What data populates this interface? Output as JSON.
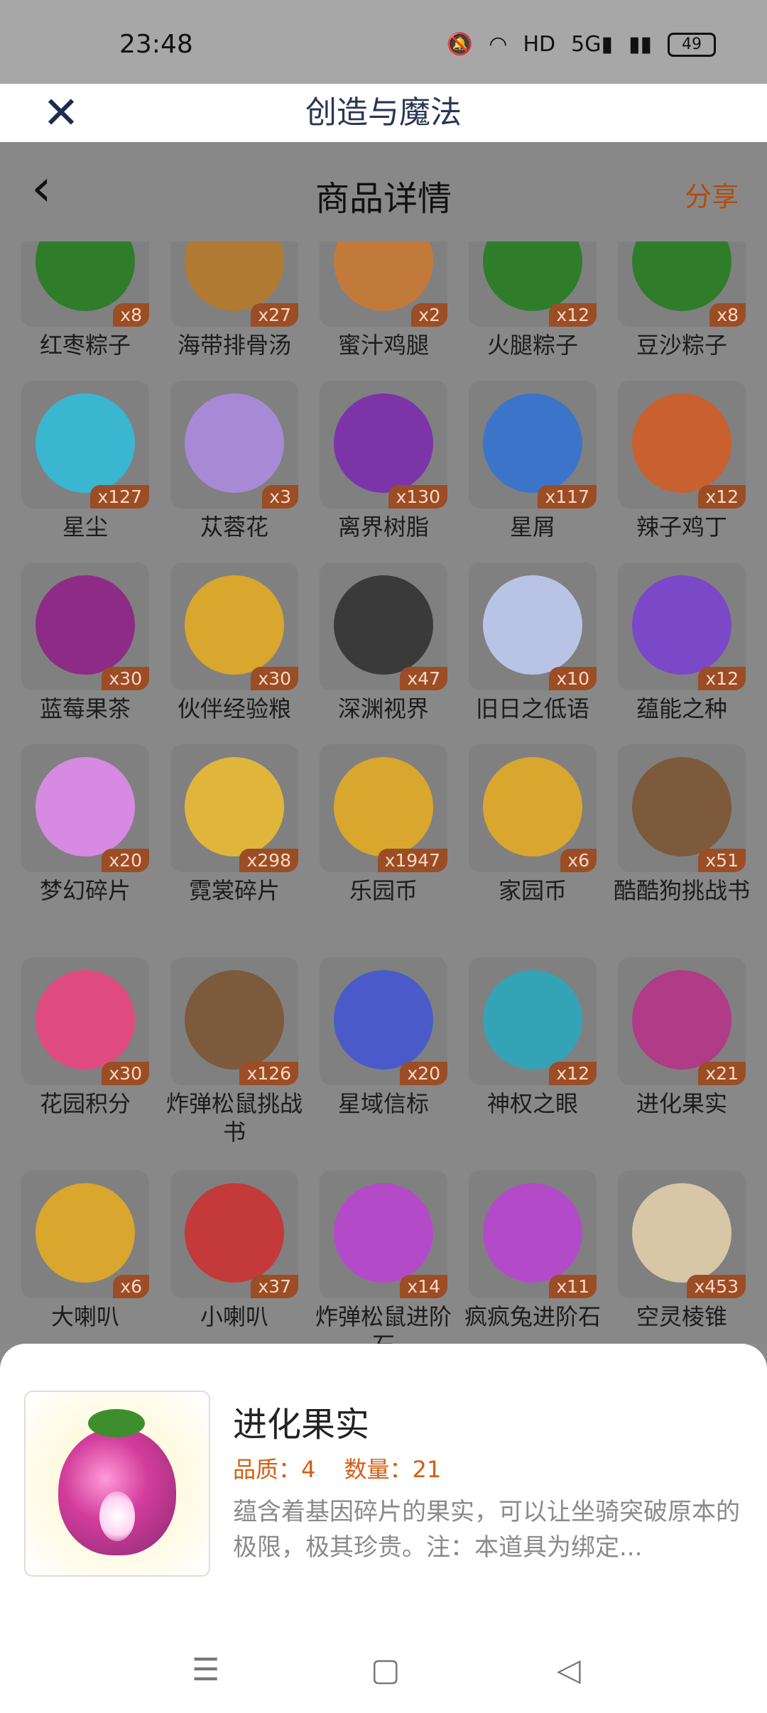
{
  "status_bar": {
    "time": "23:48",
    "battery": "49",
    "icons": [
      "bell-off-icon",
      "wifi-icon",
      "hd-icon",
      "signal-5g-icon",
      "signal-icon",
      "battery-icon"
    ]
  },
  "web_header": {
    "title": "创造与魔法"
  },
  "page_header": {
    "title": "商品详情",
    "share_label": "分享"
  },
  "items": [
    {
      "name": "红枣粽子",
      "count": "x8",
      "color": "#2f7d2a"
    },
    {
      "name": "海带排骨汤",
      "count": "x27",
      "color": "#b07a32"
    },
    {
      "name": "蜜汁鸡腿",
      "count": "x2",
      "color": "#c27a3b"
    },
    {
      "name": "火腿粽子",
      "count": "x12",
      "color": "#2f7d2a"
    },
    {
      "name": "豆沙粽子",
      "count": "x8",
      "color": "#2f7d2a"
    },
    {
      "name": "星尘",
      "count": "x127",
      "color": "#3ab6d1"
    },
    {
      "name": "苁蓉花",
      "count": "x3",
      "color": "#a78ad5"
    },
    {
      "name": "离界树脂",
      "count": "x130",
      "color": "#7b35a8"
    },
    {
      "name": "星屑",
      "count": "x117",
      "color": "#3c74c9"
    },
    {
      "name": "辣子鸡丁",
      "count": "x12",
      "color": "#c8612f"
    },
    {
      "name": "蓝莓果茶",
      "count": "x30",
      "color": "#8d2b86"
    },
    {
      "name": "伙伴经验粮",
      "count": "x30",
      "color": "#d9a62e"
    },
    {
      "name": "深渊视界",
      "count": "x47",
      "color": "#3a3a3a"
    },
    {
      "name": "旧日之低语",
      "count": "x10",
      "color": "#b9c3e5"
    },
    {
      "name": "蕴能之种",
      "count": "x12",
      "color": "#7b48c8"
    },
    {
      "name": "梦幻碎片",
      "count": "x20",
      "color": "#d78ae2"
    },
    {
      "name": "霓裳碎片",
      "count": "x298",
      "color": "#e0b53b"
    },
    {
      "name": "乐园币",
      "count": "x1947",
      "color": "#d9a62e"
    },
    {
      "name": "家园币",
      "count": "x6",
      "color": "#d9a62e"
    },
    {
      "name": "酷酷狗挑战书",
      "count": "x51",
      "color": "#7c5a3b"
    },
    {
      "name": "花园积分",
      "count": "x30",
      "color": "#e04c7f"
    },
    {
      "name": "炸弹松鼠挑战书",
      "count": "x126",
      "color": "#7c5a3b"
    },
    {
      "name": "星域信标",
      "count": "x20",
      "color": "#4a5bc9"
    },
    {
      "name": "神权之眼",
      "count": "x12",
      "color": "#35a3b6"
    },
    {
      "name": "进化果实",
      "count": "x21",
      "color": "#b03b86"
    },
    {
      "name": "大喇叭",
      "count": "x6",
      "color": "#d9a62e"
    },
    {
      "name": "小喇叭",
      "count": "x37",
      "color": "#c43a3a"
    },
    {
      "name": "炸弹松鼠进阶石",
      "count": "x14",
      "color": "#b34bc8"
    },
    {
      "name": "疯疯兔进阶石",
      "count": "x11",
      "color": "#b34bc8"
    },
    {
      "name": "空灵棱锥",
      "count": "x453",
      "color": "#d7c7a6"
    }
  ],
  "detail": {
    "name": "进化果实",
    "quality": "品质：4",
    "quantity": "数量：21",
    "description": "蕴含着基因碎片的果实，可以让坐骑突破原本的极限，极其珍贵。注：本道具为绑定..."
  },
  "system_nav": {
    "menu_icon": "☰",
    "home_icon": "▢",
    "back_icon": "◁"
  }
}
